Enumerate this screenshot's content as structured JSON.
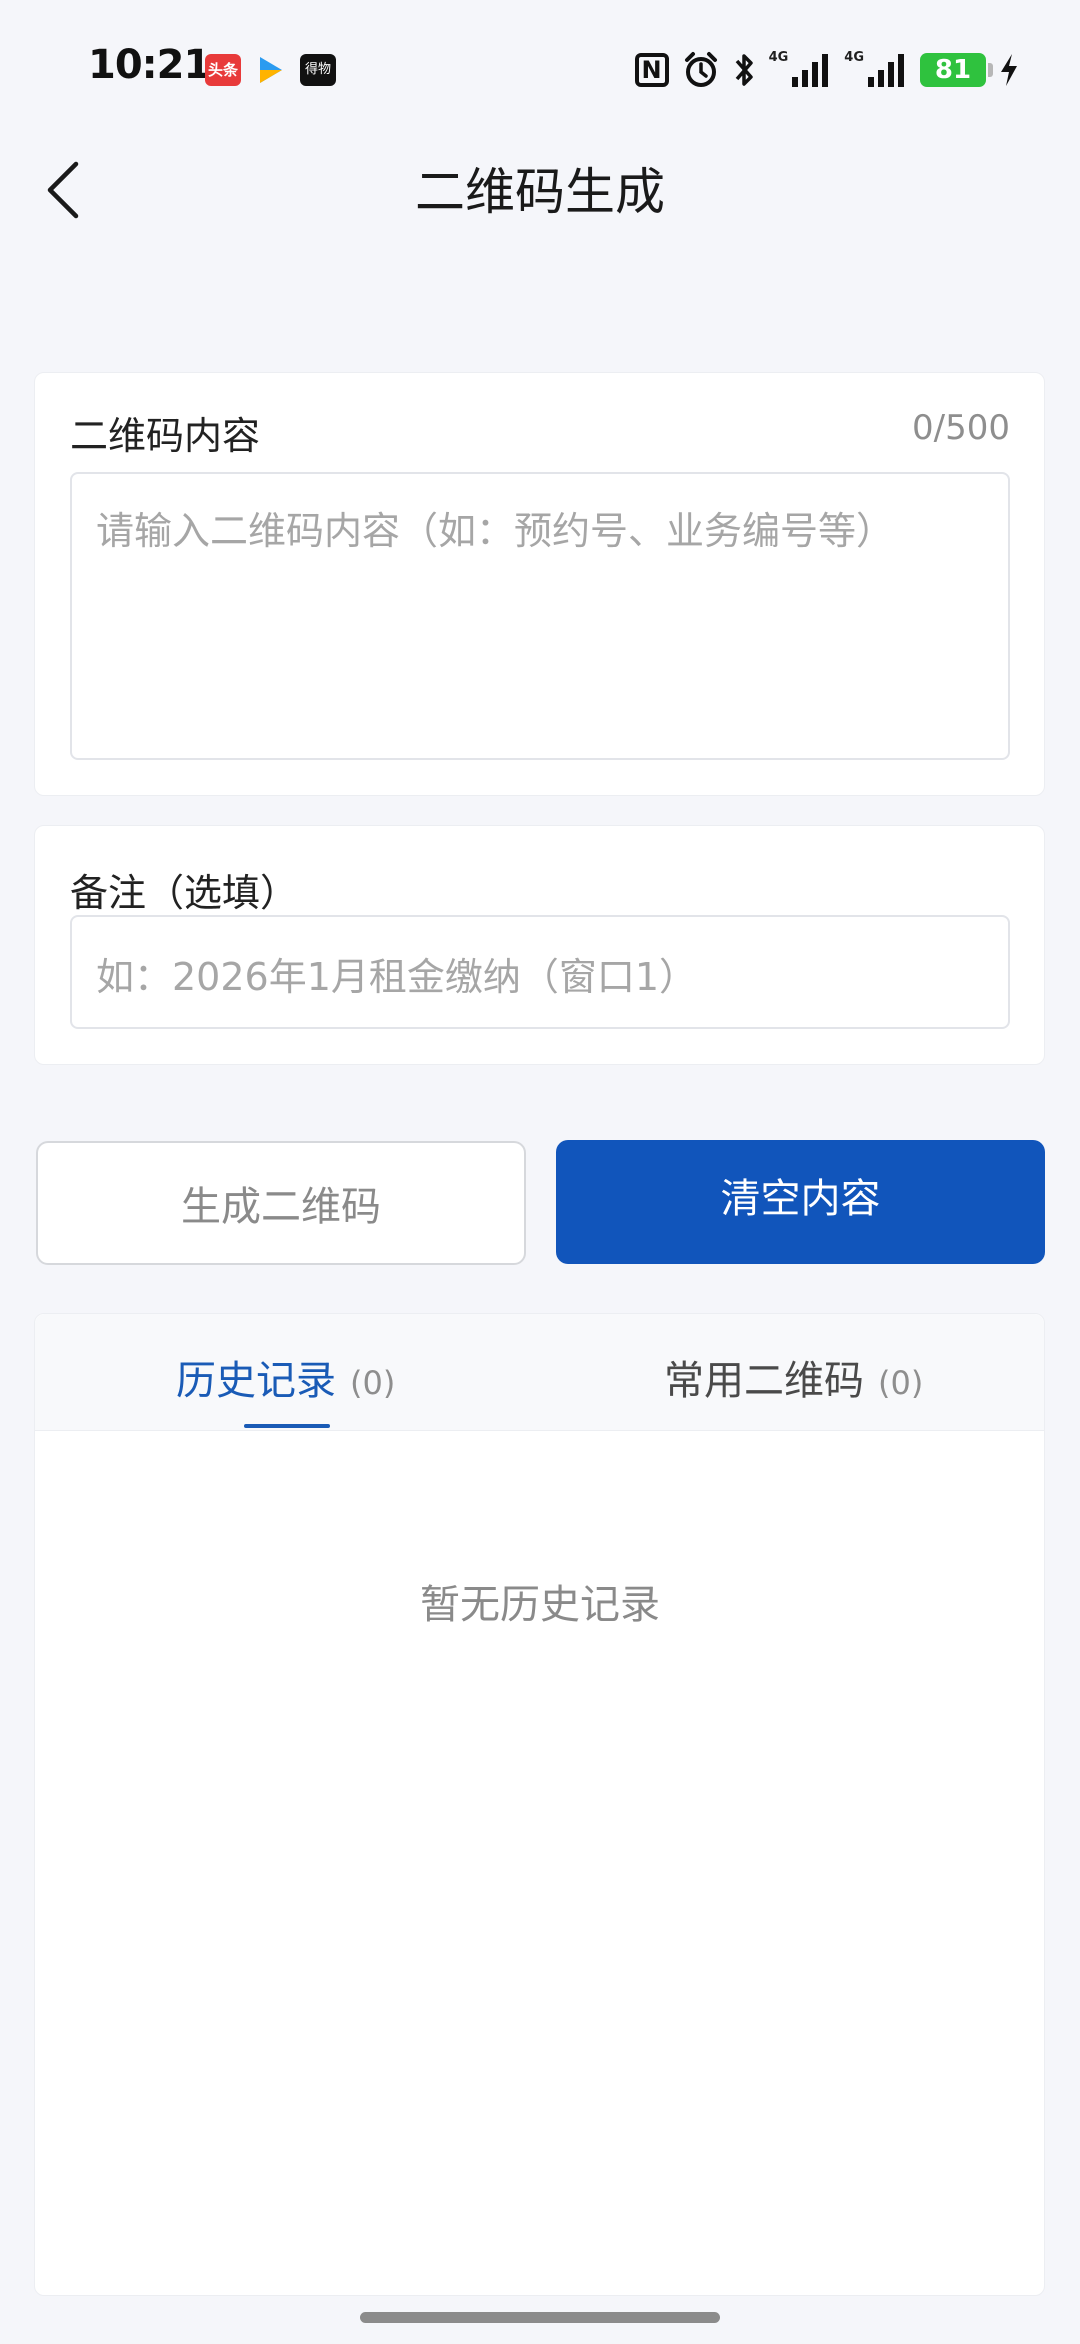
{
  "status_bar": {
    "time": "10:21",
    "app_icons": [
      "头条",
      "play-icon",
      "得物"
    ],
    "nfc": "N",
    "signal_1_label": "4G",
    "signal_2_label": "4G",
    "battery": "81"
  },
  "header": {
    "title": "二维码生成"
  },
  "content_field": {
    "label": "二维码内容",
    "counter": "0/500",
    "placeholder": "请输入二维码内容（如：预约号、业务编号等）"
  },
  "note_field": {
    "label": "备注（选填）",
    "placeholder": "如：2026年1月租金缴纳（窗口1）"
  },
  "buttons": {
    "generate": "生成二维码",
    "clear": "清空内容"
  },
  "tabs": [
    {
      "label": "历史记录",
      "count": "(0)",
      "active": true
    },
    {
      "label": "常用二维码",
      "count": "(0)",
      "active": false
    }
  ],
  "empty_state": "暂无历史记录",
  "colors": {
    "accent": "#1155bb",
    "background": "#f5f6fa",
    "battery": "#2fc23e"
  }
}
